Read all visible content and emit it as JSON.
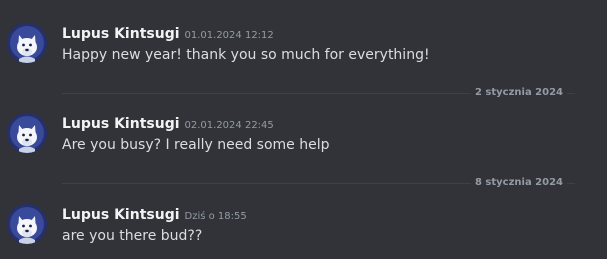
{
  "messages": [
    {
      "author": "Lupus Kintsugi",
      "timestamp": "01.01.2024 12:12",
      "text": "Happy new year! thank you so much for everything!",
      "avatar": "wolf-avatar"
    },
    {
      "author": "Lupus Kintsugi",
      "timestamp": "02.01.2024 22:45",
      "text": "Are you busy? I really need some help",
      "avatar": "wolf-avatar"
    },
    {
      "author": "Lupus Kintsugi",
      "timestamp": "Dziś o 18:55",
      "text": "are you there bud??",
      "avatar": "wolf-avatar"
    }
  ],
  "dividers": [
    {
      "label": "2 stycznia 2024"
    },
    {
      "label": "8 stycznia 2024"
    }
  ],
  "colors": {
    "background": "#313338",
    "username": "#f2f3f5",
    "text": "#dbdee1",
    "muted": "#949ba4",
    "divider": "#3f4147"
  }
}
